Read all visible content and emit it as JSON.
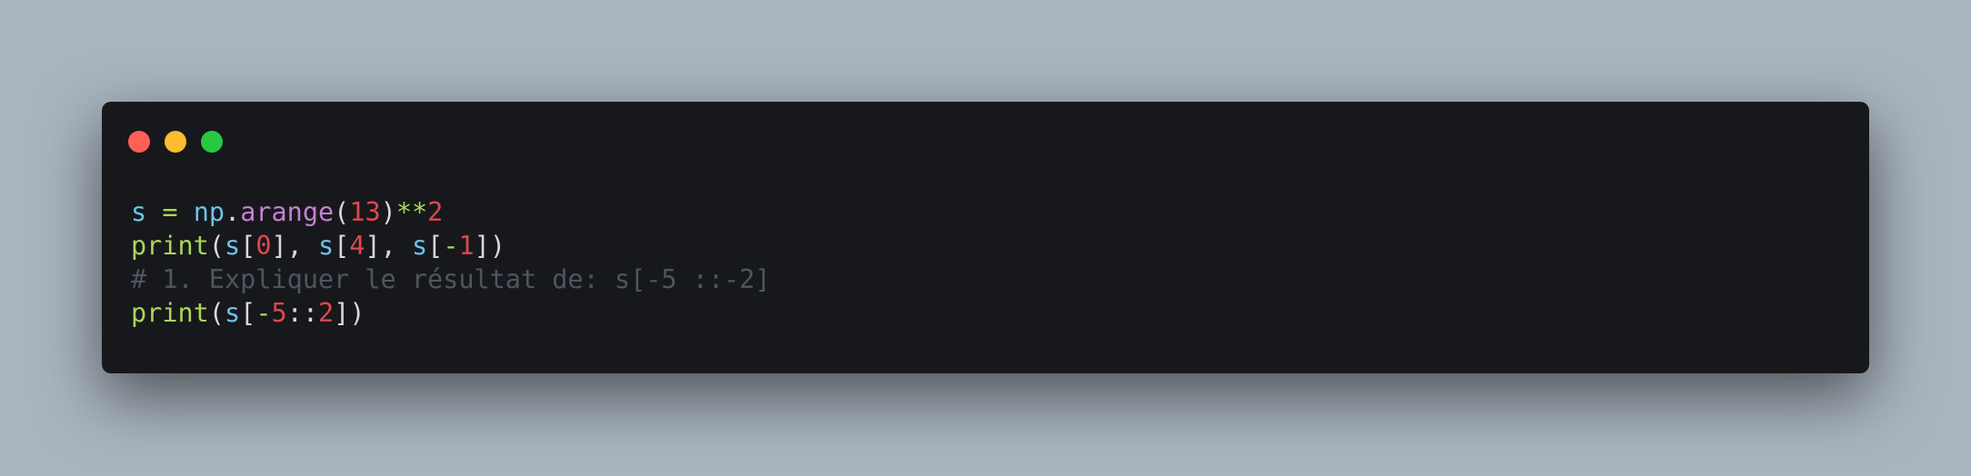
{
  "window": {
    "controls": [
      {
        "name": "close",
        "color": "#ff5f57"
      },
      {
        "name": "minimize",
        "color": "#febc2e"
      },
      {
        "name": "maximize",
        "color": "#28c840"
      }
    ]
  },
  "colors": {
    "background": "#a9b4bf",
    "editor_background": "#17181b",
    "variable": "#6cc3e8",
    "operator": "#a9d65b",
    "function": "#c47fd5",
    "number": "#e0484e",
    "comment": "#4d5660"
  },
  "code": {
    "lines": [
      [
        {
          "t": "s",
          "k": "var"
        },
        {
          "t": " ",
          "k": "punc"
        },
        {
          "t": "=",
          "k": "op"
        },
        {
          "t": " ",
          "k": "punc"
        },
        {
          "t": "np",
          "k": "var"
        },
        {
          "t": ".",
          "k": "punc"
        },
        {
          "t": "arange",
          "k": "fn"
        },
        {
          "t": "(",
          "k": "punc"
        },
        {
          "t": "13",
          "k": "num"
        },
        {
          "t": ")",
          "k": "punc"
        },
        {
          "t": "**",
          "k": "op"
        },
        {
          "t": "2",
          "k": "num"
        }
      ],
      [
        {
          "t": "print",
          "k": "print"
        },
        {
          "t": "(",
          "k": "punc"
        },
        {
          "t": "s",
          "k": "var"
        },
        {
          "t": "[",
          "k": "punc"
        },
        {
          "t": "0",
          "k": "num"
        },
        {
          "t": "], ",
          "k": "punc"
        },
        {
          "t": "s",
          "k": "var"
        },
        {
          "t": "[",
          "k": "punc"
        },
        {
          "t": "4",
          "k": "num"
        },
        {
          "t": "], ",
          "k": "punc"
        },
        {
          "t": "s",
          "k": "var"
        },
        {
          "t": "[",
          "k": "punc"
        },
        {
          "t": "-",
          "k": "op"
        },
        {
          "t": "1",
          "k": "num"
        },
        {
          "t": "])",
          "k": "punc"
        }
      ],
      [
        {
          "t": "# 1. Expliquer le résultat de: s[-5 ::-2]",
          "k": "comment"
        }
      ],
      [
        {
          "t": "print",
          "k": "print"
        },
        {
          "t": "(",
          "k": "punc"
        },
        {
          "t": "s",
          "k": "var"
        },
        {
          "t": "[",
          "k": "punc"
        },
        {
          "t": "-",
          "k": "op"
        },
        {
          "t": "5",
          "k": "num"
        },
        {
          "t": "::",
          "k": "punc"
        },
        {
          "t": "2",
          "k": "num"
        },
        {
          "t": "])",
          "k": "punc"
        }
      ]
    ]
  }
}
